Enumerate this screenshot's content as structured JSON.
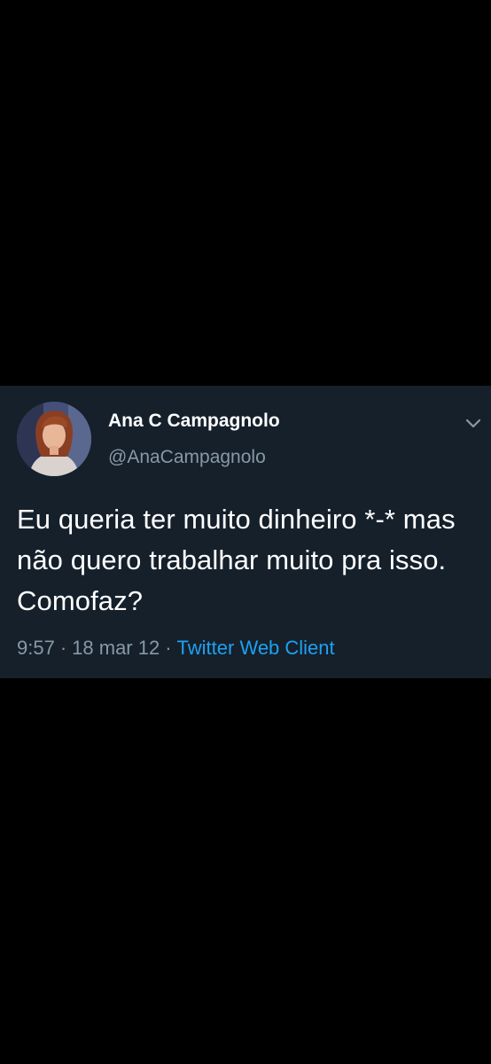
{
  "tweet": {
    "author": {
      "display_name": "Ana C Campagnolo",
      "handle": "@AnaCampagnolo"
    },
    "text": "Eu queria ter muito dinheiro *-* mas não quero trabalhar muito pra isso. Comofaz?",
    "meta": {
      "time": "9:57",
      "separator": "·",
      "date": "18 mar 12",
      "source": "Twitter Web Client"
    },
    "icons": {
      "menu": "chevron-down-icon",
      "avatar": "avatar"
    },
    "colors": {
      "background": "#15202b",
      "text": "#ffffff",
      "secondary": "#8899a6",
      "link": "#1da1f2"
    }
  }
}
